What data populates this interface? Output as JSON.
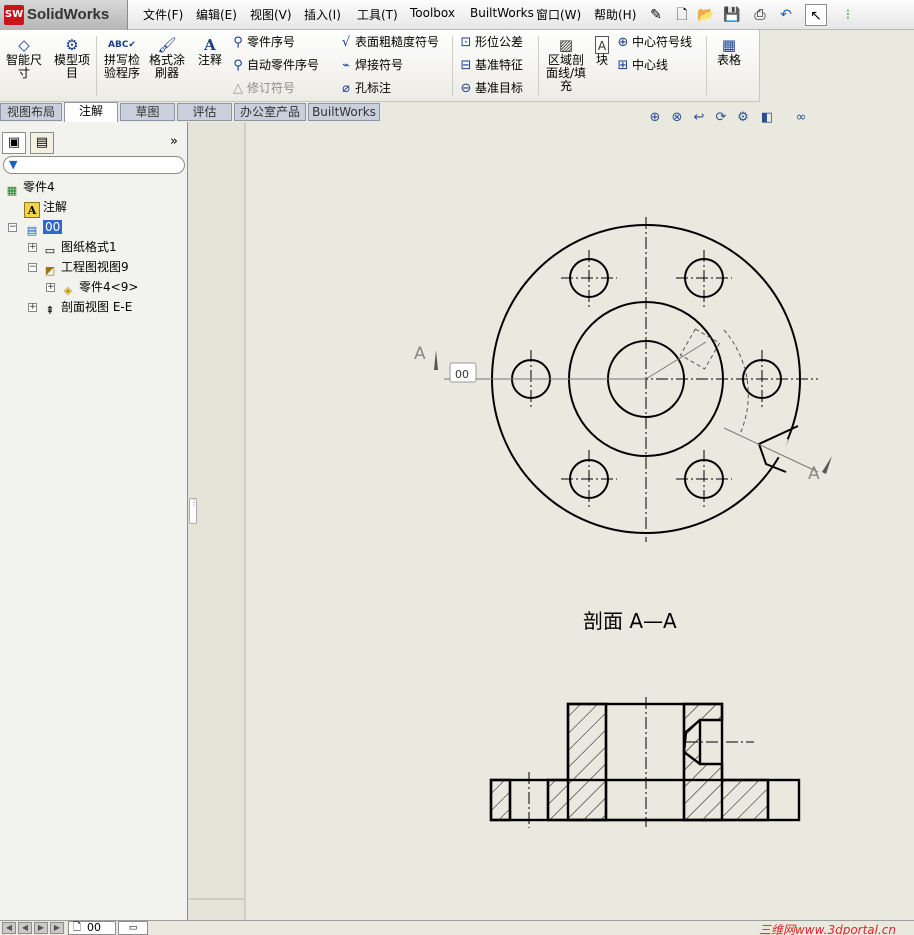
{
  "app": {
    "logo_mark": "SW",
    "logo_name": "SolidWorks"
  },
  "menu": [
    "文件(F)",
    "编辑(E)",
    "视图(V)",
    "插入(I)",
    "工具(T)",
    "Toolbox",
    "BuiltWorks",
    "窗口(W)",
    "帮助(H)"
  ],
  "ribbon": {
    "big_buttons": [
      "智能尺\n寸",
      "模型项\n目",
      "拼写检\n验程序",
      "格式涂\n刷器",
      "注释"
    ],
    "col1": [
      "零件序号",
      "自动零件序号",
      "修订符号"
    ],
    "col2": [
      "表面粗糙度符号",
      "焊接符号",
      "孔标注"
    ],
    "col3": [
      "形位公差",
      "基准特征",
      "基准目标"
    ],
    "hatch": "区域剖\n面线/填\n充",
    "block": "块",
    "col4": [
      "中心符号线",
      "中心线"
    ],
    "table": "表格"
  },
  "tabs": [
    "视图布局",
    "注解",
    "草图",
    "评估",
    "办公室产品",
    "BuiltWorks"
  ],
  "active_tab": "注解",
  "tree": {
    "root": "零件4",
    "annotations": "注解",
    "sheet": "00",
    "sheet_format": "图纸格式1",
    "drawing_view": "工程图视图9",
    "part_ref": "零件4<9>",
    "section_view": "剖面视图 E-E"
  },
  "drawing": {
    "section_title": "剖面  A—A",
    "label_left": "A",
    "label_right": "A",
    "view_tag": "00"
  },
  "bottom": {
    "sheet_tab": "00",
    "watermark": "三维网www.3dportal.cn"
  },
  "colors": {
    "accent": "#316ac5",
    "logo_red": "#c8141a",
    "watermark": "#e0262b"
  }
}
